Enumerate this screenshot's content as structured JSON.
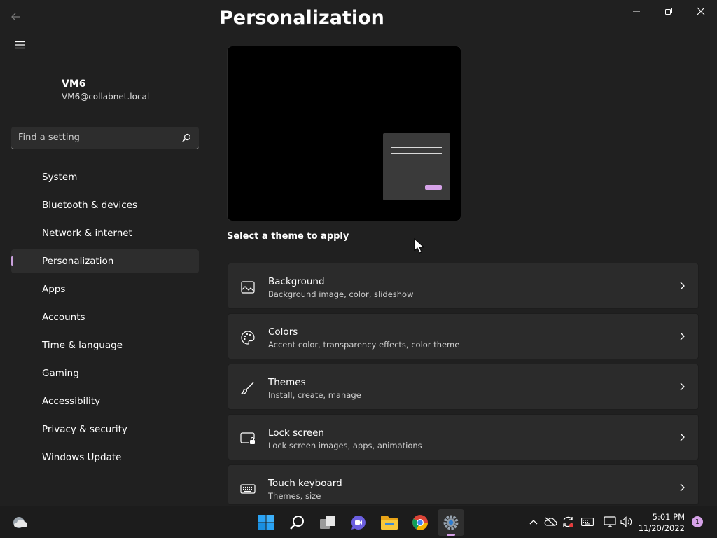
{
  "titlebar": {
    "back_icon": "arrow-left-icon",
    "minimize_icon": "minimize-icon",
    "maximize_icon": "restore-icon",
    "close_icon": "close-icon"
  },
  "sidebar": {
    "menu_icon": "hamburger-icon",
    "user": {
      "name": "VM6",
      "email": "VM6@collabnet.local"
    },
    "search": {
      "placeholder": "Find a setting",
      "icon": "search-icon"
    },
    "items": [
      {
        "label": "System",
        "active": false
      },
      {
        "label": "Bluetooth & devices",
        "active": false
      },
      {
        "label": "Network & internet",
        "active": false
      },
      {
        "label": "Personalization",
        "active": true
      },
      {
        "label": "Apps",
        "active": false
      },
      {
        "label": "Accounts",
        "active": false
      },
      {
        "label": "Time & language",
        "active": false
      },
      {
        "label": "Gaming",
        "active": false
      },
      {
        "label": "Accessibility",
        "active": false
      },
      {
        "label": "Privacy & security",
        "active": false
      },
      {
        "label": "Windows Update",
        "active": false
      }
    ]
  },
  "main": {
    "title": "Personalization",
    "select_theme_label": "Select a theme to apply",
    "cards": [
      {
        "title": "Background",
        "subtitle": "Background image, color, slideshow",
        "icon": "image-icon"
      },
      {
        "title": "Colors",
        "subtitle": "Accent color, transparency effects, color theme",
        "icon": "palette-icon"
      },
      {
        "title": "Themes",
        "subtitle": "Install, create, manage",
        "icon": "brush-icon"
      },
      {
        "title": "Lock screen",
        "subtitle": "Lock screen images, apps, animations",
        "icon": "lock-screen-icon"
      },
      {
        "title": "Touch keyboard",
        "subtitle": "Themes, size",
        "icon": "keyboard-icon"
      }
    ]
  },
  "taskbar": {
    "apps": [
      "start-icon",
      "search-icon",
      "task-view-icon",
      "chat-icon",
      "file-explorer-icon",
      "chrome-icon",
      "settings-icon"
    ],
    "active_app": "settings-icon",
    "tray": [
      "chevron-up-icon",
      "onedrive-offline-icon",
      "sync-icon",
      "keyboard-icon",
      "network-icon",
      "volume-icon"
    ],
    "time": "5:01 PM",
    "date": "11/20/2022",
    "notification_count": "1"
  },
  "colors": {
    "background": "#202020",
    "card": "#2b2b2b",
    "accent": "#d6a2e8"
  }
}
